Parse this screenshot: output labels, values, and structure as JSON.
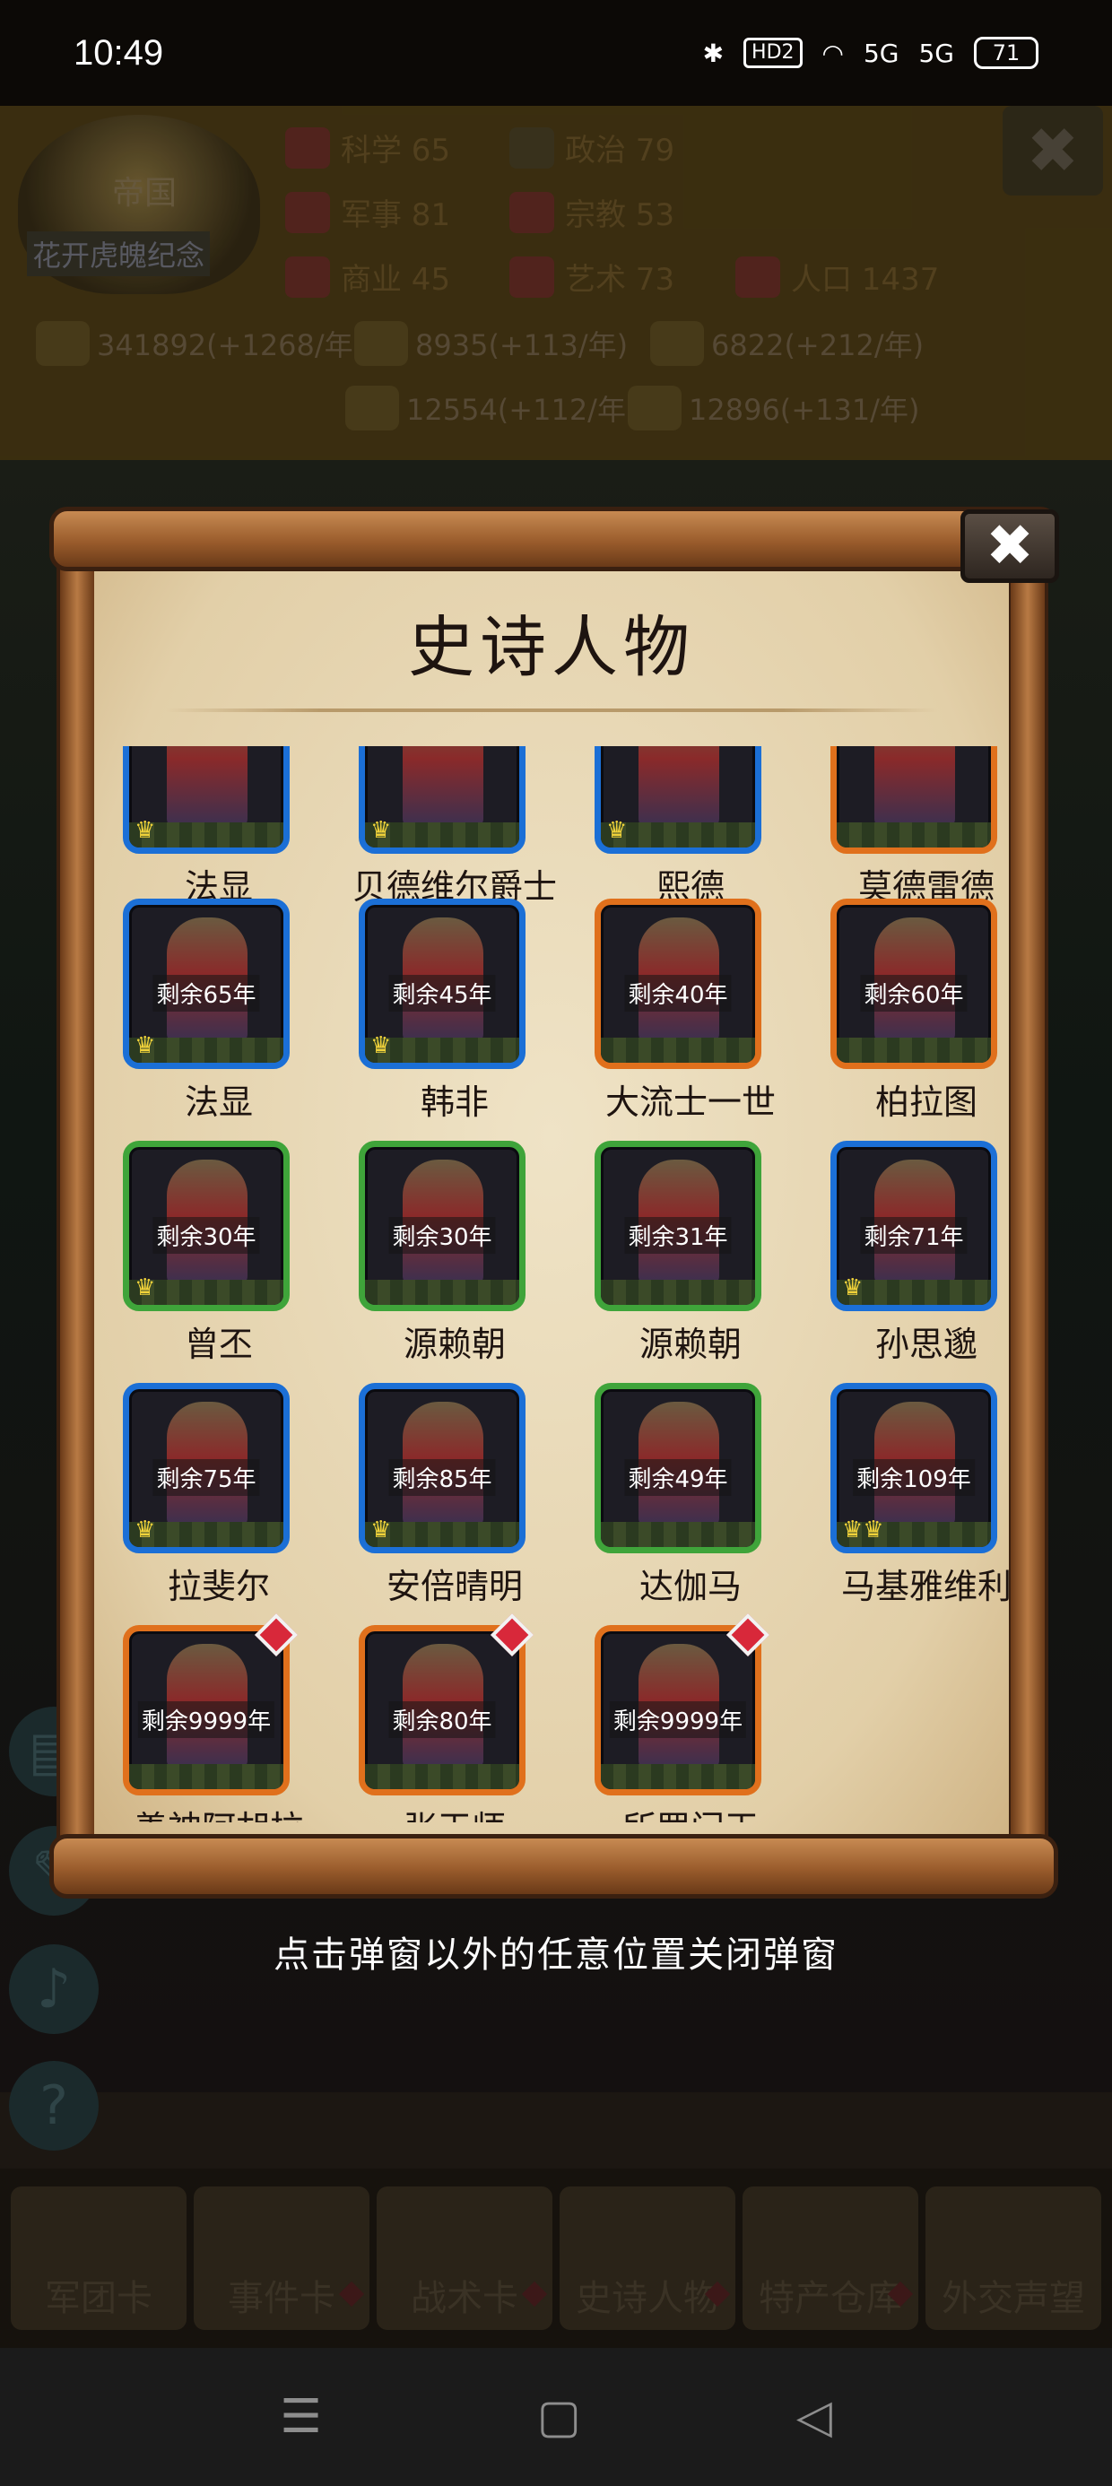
{
  "status_bar": {
    "time": "10:49",
    "bluetooth_icon": "bluetooth-icon",
    "hd_label": "HD2",
    "wifi_icon": "wifi-icon",
    "signal1": "5G",
    "signal2": "5G",
    "battery": "71"
  },
  "empire": {
    "emblem_label": "帝国",
    "name": "花开虎魄纪念"
  },
  "stats": {
    "science": "科学 65",
    "politics": "政治 79",
    "military": "军事 81",
    "religion": "宗教 53",
    "commerce": "商业 45",
    "art": "艺术 73",
    "population": "人口 1437"
  },
  "resources": {
    "gold": "341892(+1268/年)",
    "wood": "8935(+113/年)",
    "iron": "6822(+212/年)",
    "stone": "12554(+112/年)",
    "food": "12896(+131/年)"
  },
  "dialog": {
    "title": "史诗人物",
    "close_label": "✖",
    "partial_names": [
      "法显",
      "贝德维尔爵士",
      "熙德",
      "莫德雷德"
    ],
    "cards": [
      {
        "name": "法显",
        "timer": "剩余65年",
        "border": "blue",
        "crown": "♛"
      },
      {
        "name": "韩非",
        "timer": "剩余45年",
        "border": "blue",
        "crown": "♛"
      },
      {
        "name": "大流士一世",
        "timer": "剩余40年",
        "border": "orange",
        "crown": ""
      },
      {
        "name": "柏拉图",
        "timer": "剩余60年",
        "border": "orange",
        "crown": ""
      },
      {
        "name": "曾丕",
        "timer": "剩余30年",
        "border": "green",
        "crown": "♛"
      },
      {
        "name": "源赖朝",
        "timer": "剩余30年",
        "border": "green",
        "crown": ""
      },
      {
        "name": "源赖朝",
        "timer": "剩余31年",
        "border": "green",
        "crown": ""
      },
      {
        "name": "孙思邈",
        "timer": "剩余71年",
        "border": "blue",
        "crown": "♛"
      },
      {
        "name": "拉斐尔",
        "timer": "剩余75年",
        "border": "blue",
        "crown": "♛"
      },
      {
        "name": "安倍晴明",
        "timer": "剩余85年",
        "border": "blue",
        "crown": "♛"
      },
      {
        "name": "达伽马",
        "timer": "剩余49年",
        "border": "green",
        "crown": ""
      },
      {
        "name": "马基雅维利",
        "timer": "剩余109年",
        "border": "blue",
        "crown": "♛♛"
      },
      {
        "name": "善神阿胡拉",
        "timer": "剩余9999年",
        "border": "orange",
        "crown": "",
        "diamond": true
      },
      {
        "name": "张天师",
        "timer": "剩余80年",
        "border": "orange",
        "crown": "",
        "diamond": true
      },
      {
        "name": "所罗门王",
        "timer": "剩余9999年",
        "border": "orange",
        "crown": "",
        "diamond": true
      }
    ]
  },
  "hint": "点击弹窗以外的任意位置关闭弹窗",
  "tabs": [
    "军团卡",
    "事件卡",
    "战术卡",
    "史诗人物",
    "特产仓库",
    "外交声望"
  ],
  "nav": {
    "menu_icon": "☰",
    "home_icon": "▢",
    "back_icon": "◁"
  },
  "background_close": "✖"
}
